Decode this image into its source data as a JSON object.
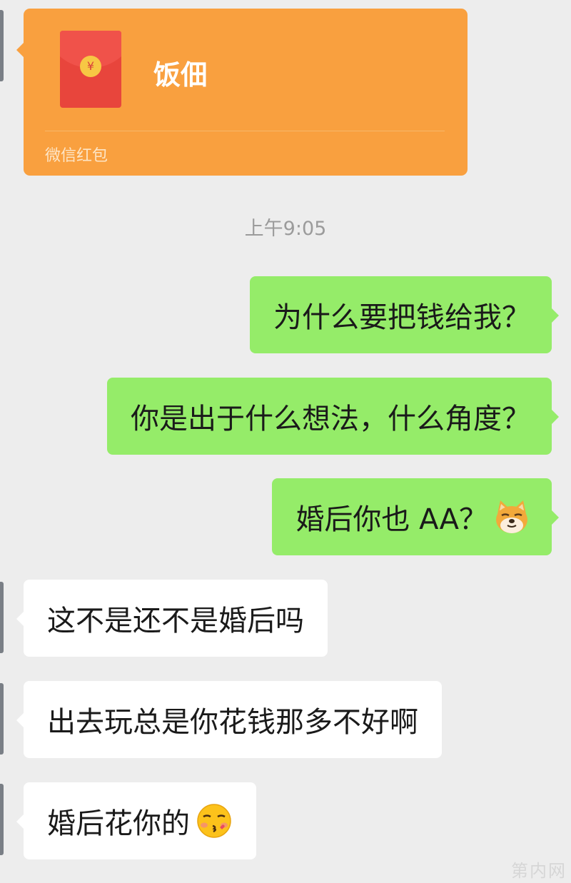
{
  "red_packet": {
    "title": "饭佃",
    "label": "微信红包",
    "coin_symbol": "¥"
  },
  "timestamp": "上午9:05",
  "messages": [
    {
      "side": "sent",
      "text": "为什么要把钱给我？"
    },
    {
      "side": "sent",
      "text": "你是出于什么想法，什么角度？"
    },
    {
      "side": "sent",
      "text": "婚后你也 AA？",
      "emoji": "doge-emoji"
    },
    {
      "side": "received",
      "text": "这不是还不是婚后吗"
    },
    {
      "side": "received",
      "text": "出去玩总是你花钱那多不好啊"
    },
    {
      "side": "received",
      "text": "婚后花你的",
      "emoji": "kissing-face-emoji"
    }
  ],
  "watermark": "第内网",
  "colors": {
    "background": "#ededed",
    "sent_bubble": "#95ec69",
    "received_bubble": "#ffffff",
    "red_packet": "#f9a03f"
  }
}
